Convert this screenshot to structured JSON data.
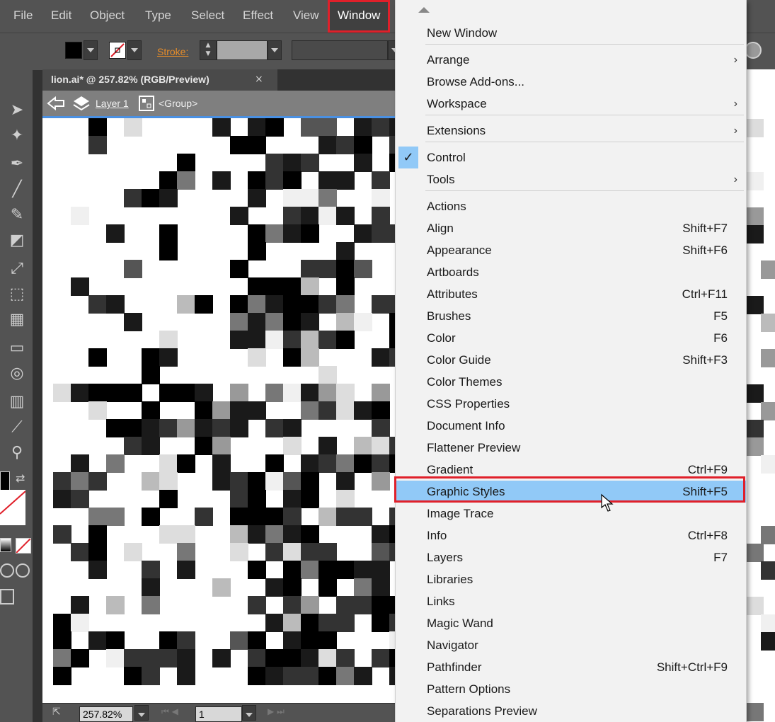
{
  "menubar": {
    "items": [
      "File",
      "Edit",
      "Object",
      "Type",
      "Select",
      "Effect",
      "View",
      "Window"
    ],
    "active": "Window"
  },
  "control": {
    "stroke_label": "Stroke:"
  },
  "document": {
    "tab_title": "lion.ai* @ 257.82% (RGB/Preview)",
    "close": "×",
    "layer": "Layer 1",
    "group": "<Group>"
  },
  "status": {
    "zoom": "257.82%",
    "page": "1"
  },
  "window_menu": {
    "items": [
      {
        "label": "New Window",
        "shortcut": "",
        "submenu": false
      },
      {
        "label": "Arrange",
        "shortcut": "",
        "submenu": true
      },
      {
        "label": "Browse Add-ons...",
        "shortcut": "",
        "submenu": false
      },
      {
        "label": "Workspace",
        "shortcut": "",
        "submenu": true
      },
      {
        "label": "Extensions",
        "shortcut": "",
        "submenu": true
      },
      {
        "label": "Control",
        "shortcut": "",
        "submenu": false,
        "checked": true
      },
      {
        "label": "Tools",
        "shortcut": "",
        "submenu": true
      },
      {
        "label": "Actions",
        "shortcut": "",
        "submenu": false
      },
      {
        "label": "Align",
        "shortcut": "Shift+F7",
        "submenu": false
      },
      {
        "label": "Appearance",
        "shortcut": "Shift+F6",
        "submenu": false
      },
      {
        "label": "Artboards",
        "shortcut": "",
        "submenu": false
      },
      {
        "label": "Attributes",
        "shortcut": "Ctrl+F11",
        "submenu": false
      },
      {
        "label": "Brushes",
        "shortcut": "F5",
        "submenu": false
      },
      {
        "label": "Color",
        "shortcut": "F6",
        "submenu": false
      },
      {
        "label": "Color Guide",
        "shortcut": "Shift+F3",
        "submenu": false
      },
      {
        "label": "Color Themes",
        "shortcut": "",
        "submenu": false
      },
      {
        "label": "CSS Properties",
        "shortcut": "",
        "submenu": false
      },
      {
        "label": "Document Info",
        "shortcut": "",
        "submenu": false
      },
      {
        "label": "Flattener Preview",
        "shortcut": "",
        "submenu": false
      },
      {
        "label": "Gradient",
        "shortcut": "Ctrl+F9",
        "submenu": false
      },
      {
        "label": "Graphic Styles",
        "shortcut": "Shift+F5",
        "submenu": false,
        "highlighted": true
      },
      {
        "label": "Image Trace",
        "shortcut": "",
        "submenu": false
      },
      {
        "label": "Info",
        "shortcut": "Ctrl+F8",
        "submenu": false
      },
      {
        "label": "Layers",
        "shortcut": "F7",
        "submenu": false
      },
      {
        "label": "Libraries",
        "shortcut": "",
        "submenu": false
      },
      {
        "label": "Links",
        "shortcut": "",
        "submenu": false
      },
      {
        "label": "Magic Wand",
        "shortcut": "",
        "submenu": false
      },
      {
        "label": "Navigator",
        "shortcut": "",
        "submenu": false
      },
      {
        "label": "Pathfinder",
        "shortcut": "Shift+Ctrl+F9",
        "submenu": false
      },
      {
        "label": "Pattern Options",
        "shortcut": "",
        "submenu": false
      },
      {
        "label": "Separations Preview",
        "shortcut": "",
        "submenu": false
      }
    ]
  },
  "colors": {
    "highlight": "#91c9f7",
    "callout_red": "#e0202a",
    "stroke_label": "#e58c2a"
  }
}
